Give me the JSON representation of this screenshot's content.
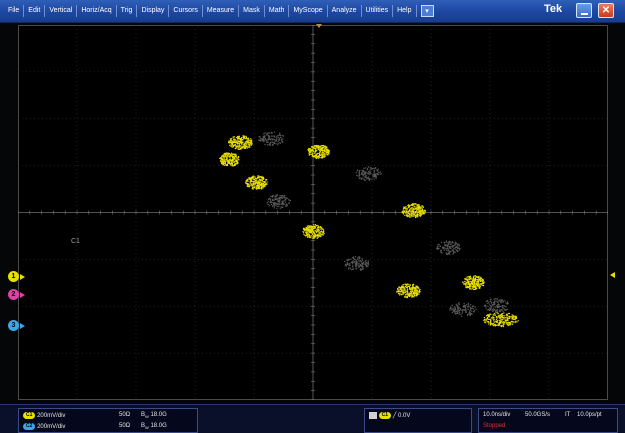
{
  "menubar": {
    "items": [
      "File",
      "Edit",
      "Vertical",
      "Horiz/Acq",
      "Trig",
      "Display",
      "Cursors",
      "Measure",
      "Mask",
      "Math",
      "MyScope",
      "Analyze",
      "Utilities",
      "Help"
    ],
    "brand": "Tek"
  },
  "screen": {
    "marker_text": "C1",
    "channel_markers": [
      {
        "label": "1",
        "color": "#e8e000"
      },
      {
        "label": "2",
        "color": "#e040a8"
      },
      {
        "label": "3",
        "color": "#3aa8e8"
      }
    ]
  },
  "status": {
    "ch1": {
      "badge": "C1",
      "scale": "200mV/div",
      "impedance": "50Ω",
      "bw": "18.0G"
    },
    "ch2": {
      "badge": "C2",
      "scale": "200mV/div",
      "impedance": "50Ω",
      "bw": "18.0G"
    },
    "trigger": {
      "badge": "C1",
      "level": "0.0V"
    },
    "timebase": {
      "horiz": "10.0ns/div",
      "rate": "50.0GS/s",
      "it": "IT",
      "res": "10.0ps/pt",
      "state": "Stopped"
    }
  },
  "colors": {
    "ch1": "#e8e000",
    "ch2": "#e040a8",
    "ch3": "#3aa8e8",
    "grid": "#3a3a3a",
    "ghost": "#5a5a5a"
  }
}
